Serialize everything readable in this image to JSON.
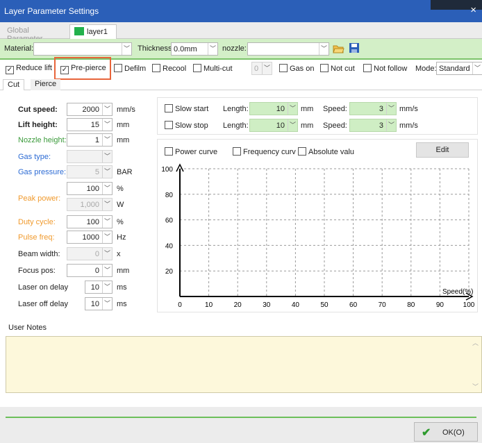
{
  "window": {
    "title": "Layer Parameter Settings",
    "close_glyph": "×"
  },
  "layer_tabs": {
    "global": "Global Parameter",
    "layer": "layer1",
    "layer_color": "#22b14c"
  },
  "material_bar": {
    "material_label": "Material:",
    "material_value": "",
    "thickness_label": "Thickness:",
    "thickness_value": "0.0mm",
    "nozzle_label": "nozzle:",
    "nozzle_value": "",
    "open_icon": "folder-open-icon",
    "save_icon": "save-icon"
  },
  "options": {
    "reduce_lift": {
      "label": "Reduce lift",
      "checked": true
    },
    "pre_pierce": {
      "label": "Pre-pierce",
      "checked": true
    },
    "defilm": {
      "label": "Defilm",
      "checked": false
    },
    "recool": {
      "label": "Recool",
      "checked": false
    },
    "multi_cut": {
      "label": "Multi-cut",
      "checked": false
    },
    "multi_cut_value": "0",
    "gas_on": {
      "label": "Gas on",
      "checked": false
    },
    "not_cut": {
      "label": "Not cut",
      "checked": false
    },
    "not_follow": {
      "label": "Not follow",
      "checked": false
    },
    "mode_label": "Mode:",
    "mode_value": "Standard"
  },
  "sub_tabs": {
    "cut": "Cut",
    "pierce": "Pierce"
  },
  "cut_params": [
    {
      "label": "Cut speed:",
      "value": "2000",
      "unit": "mm/s",
      "style": "bold"
    },
    {
      "label": "Lift height:",
      "value": "15",
      "unit": "mm",
      "style": "bold"
    },
    {
      "label": "Nozzle height:",
      "value": "1",
      "unit": "mm",
      "style": "blue"
    },
    {
      "label": "Gas type:",
      "value": "",
      "unit": "",
      "style": "blue",
      "disabled": true
    },
    {
      "label": "Gas pressure:",
      "value": "5",
      "unit": "BAR",
      "style": "blue",
      "disabled": true
    },
    {
      "label": "",
      "value": "100",
      "unit": "%",
      "style": "orange"
    },
    {
      "label": "Peak power:",
      "value": "1,000",
      "unit": "W",
      "style": "orange",
      "disabled": true
    },
    {
      "label": "Duty cycle:",
      "value": "100",
      "unit": "%",
      "style": "orange"
    },
    {
      "label": "Pulse freq:",
      "value": "1000",
      "unit": "Hz",
      "style": "orange"
    },
    {
      "label": "Beam width:",
      "value": "0",
      "unit": "x",
      "style": "normal",
      "disabled": true
    },
    {
      "label": "Focus pos:",
      "value": "0",
      "unit": "mm",
      "style": "normal"
    },
    {
      "label": "Laser on delay",
      "value": "10",
      "unit": "ms",
      "style": "normal"
    },
    {
      "label": "Laser off delay",
      "value": "10",
      "unit": "ms",
      "style": "normal"
    }
  ],
  "slow_start": {
    "label": "Slow start",
    "length_label": "Length:",
    "length_value": "10",
    "length_unit": "mm",
    "speed_label": "Speed:",
    "speed_value": "3",
    "speed_unit": "mm/s",
    "checked": false
  },
  "slow_stop": {
    "label": "Slow stop",
    "length_label": "Length:",
    "length_value": "10",
    "length_unit": "mm",
    "speed_label": "Speed:",
    "speed_value": "3",
    "speed_unit": "mm/s",
    "checked": false
  },
  "curve_options": {
    "power_curve": "Power curve",
    "frequency_curve": "Frequency curv",
    "absolute_value": "Absolute valu",
    "edit": "Edit"
  },
  "chart_data": {
    "type": "line",
    "x_ticks": [
      "0",
      "10",
      "20",
      "30",
      "40",
      "50",
      "60",
      "70",
      "80",
      "90",
      "100"
    ],
    "y_ticks": [
      "20",
      "40",
      "60",
      "80",
      "100"
    ],
    "x_label": "Speed(%)",
    "xlim": [
      0,
      100
    ],
    "ylim": [
      0,
      100
    ],
    "grid": true,
    "series": []
  },
  "notes": {
    "label": "User Notes",
    "value": ""
  },
  "ok_button": {
    "label": "OK(O)"
  }
}
